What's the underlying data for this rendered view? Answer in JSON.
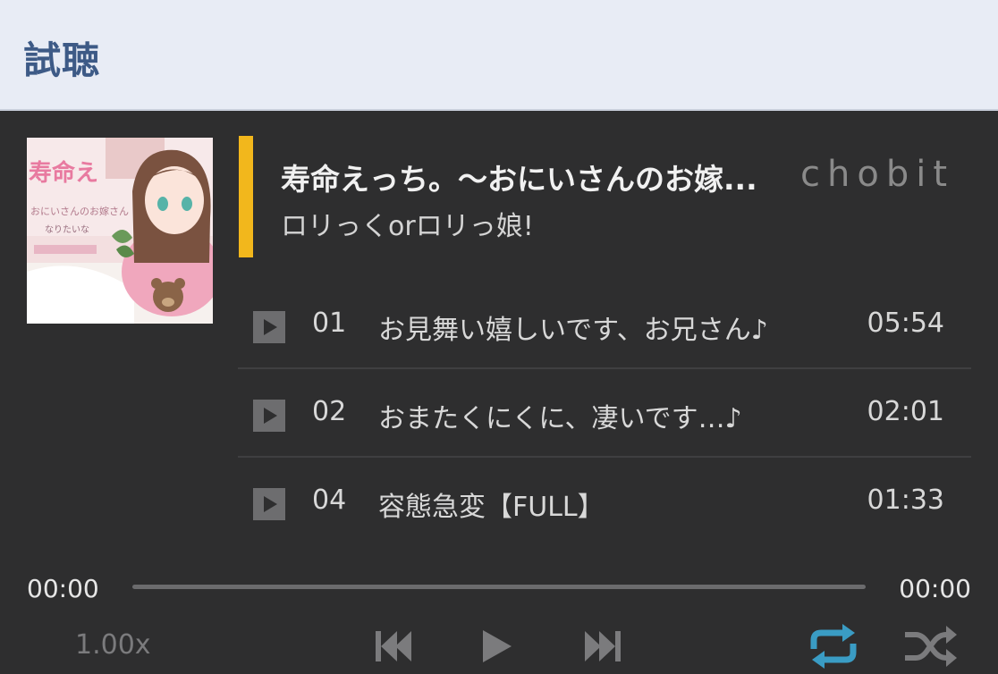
{
  "header": {
    "title": "試聴"
  },
  "album": {
    "title": "寿命えっち。〜おにいさんのお嫁...",
    "brand": "chobit",
    "circle": "ロリっくorロリっ娘!",
    "accent_color": "#f2b71c",
    "cover": {
      "cover_text": "寿命えっち。"
    }
  },
  "tracks": [
    {
      "no": "01",
      "title": "お見舞い嬉しいです、お兄さん♪",
      "duration": "05:54"
    },
    {
      "no": "02",
      "title": "おまたくにくに、凄いです…♪",
      "duration": "02:01"
    },
    {
      "no": "04",
      "title": "容態急変【FULL】",
      "duration": "01:33"
    }
  ],
  "player": {
    "current_time": "00:00",
    "total_time": "00:00",
    "progress": 0,
    "speed": "1.00x",
    "repeat_active": true,
    "repeat_color": "#3a9cc4",
    "icons": [
      "prev-icon",
      "play-icon",
      "next-icon",
      "repeat-icon",
      "shuffle-icon"
    ]
  }
}
